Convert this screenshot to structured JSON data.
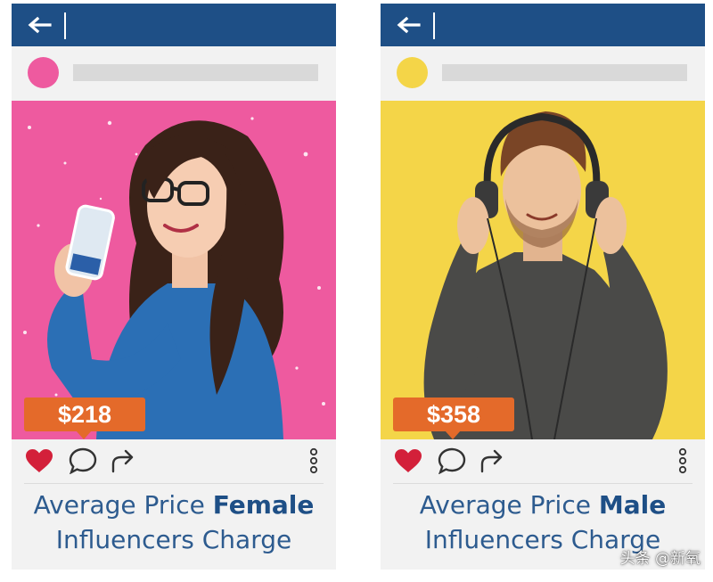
{
  "colors": {
    "header_bar": "#1e4f86",
    "caption_text": "#2d5b8f",
    "price_tag": "#e46a2a",
    "heart": "#d3203a",
    "left_photo_bg": "#ee5a9f",
    "left_avatar": "#ee5a9f",
    "right_photo_bg": "#f4d548",
    "right_avatar": "#f4d548"
  },
  "icons": {
    "back": "arrow-left-icon",
    "like": "heart-icon",
    "comment": "comment-icon",
    "share": "share-icon",
    "more": "more-vertical-icon"
  },
  "cards": [
    {
      "price": "$218",
      "caption_line1_prefix": "Average Price ",
      "caption_line1_bold": "Female",
      "caption_line2": "Influencers Charge"
    },
    {
      "price": "$358",
      "caption_line1_prefix": "Average Price ",
      "caption_line1_bold": "Male",
      "caption_line2": "Influencers Charge"
    }
  ],
  "watermark": "头条 @新氧"
}
